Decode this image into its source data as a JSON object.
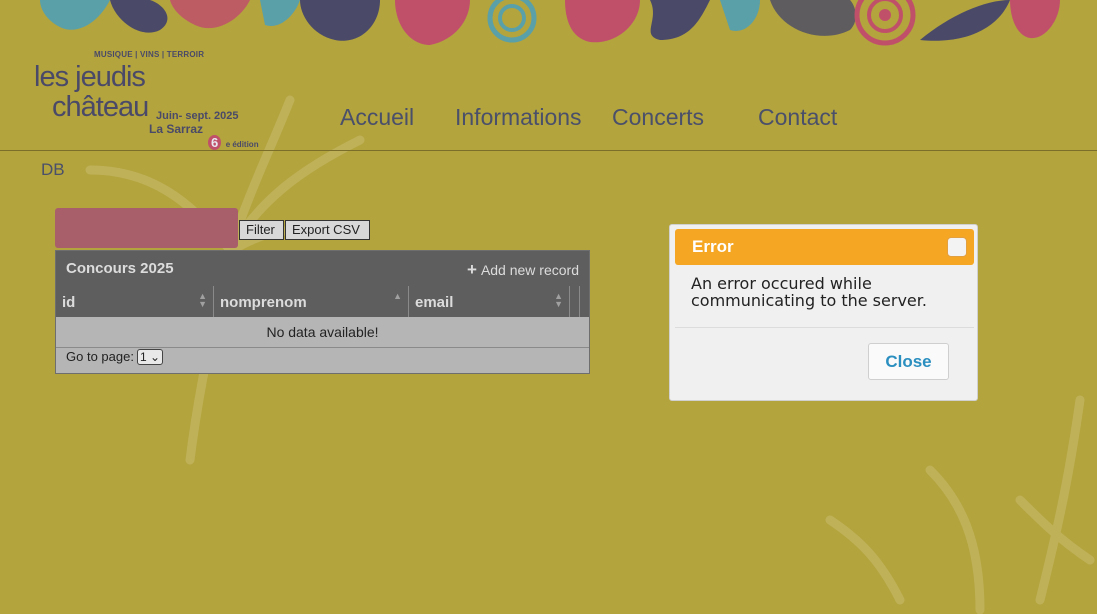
{
  "logo": {
    "tagline": "MUSIQUE | VINS | TERROIR",
    "line1": "les jeudis",
    "line2": "château",
    "dates": "Juin- sept. 2025",
    "place": "La Sarraz",
    "edition_number": "6",
    "edition_suffix": "e édition"
  },
  "nav": {
    "items": [
      "Accueil",
      "Informations",
      "Concerts",
      "Contact"
    ]
  },
  "section_label": "DB",
  "toolbar": {
    "filter_placeholder": "",
    "filter_button": "Filter",
    "export_button": "Export CSV"
  },
  "table": {
    "title": "Concours 2025",
    "add_record_label": "Add new record",
    "add_record_icon": "plus-icon",
    "columns": [
      "id",
      "nomprenom",
      "email"
    ],
    "empty_message": "No data available!",
    "pager_label": "Go to page:",
    "pager_value": "1"
  },
  "modal": {
    "title": "Error",
    "message": "An error occured while communicating to the server.",
    "close_button": "Close",
    "header_color": "#f5a623",
    "close_color": "#2b8fc0"
  },
  "colors": {
    "background": "#b3a43e",
    "filter_field": "#a95f6a",
    "table_header": "#5e5e5e"
  }
}
